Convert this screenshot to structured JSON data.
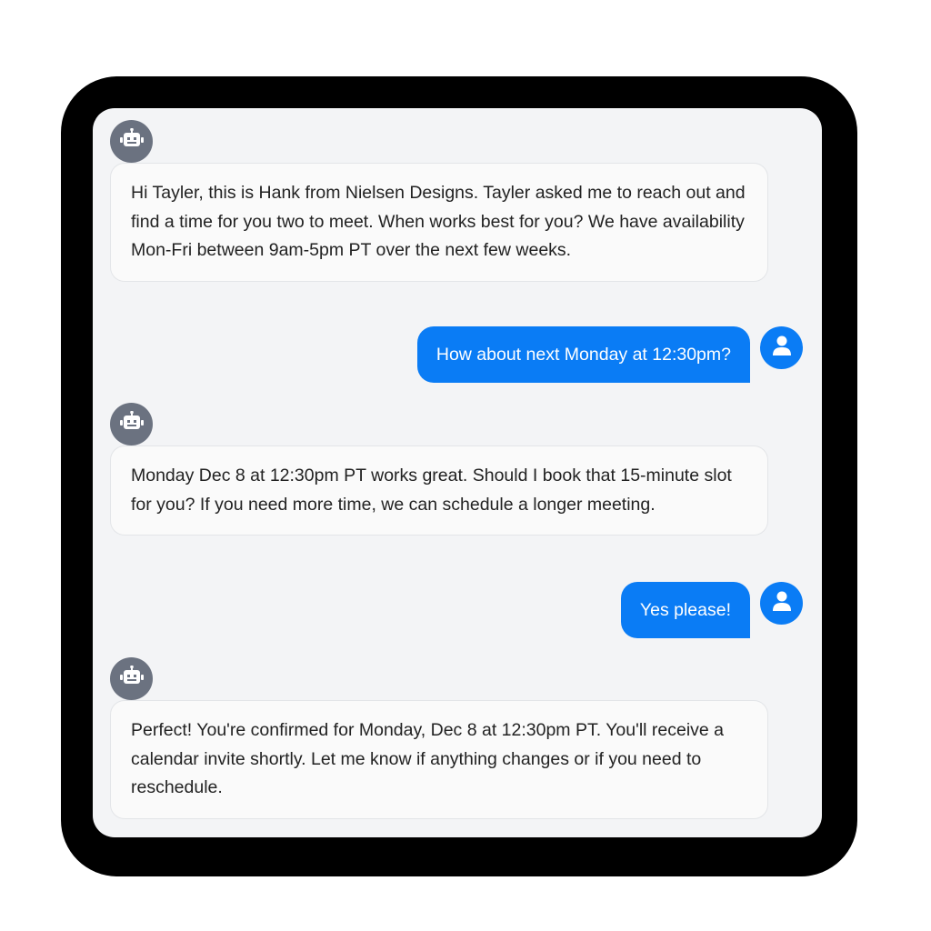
{
  "messages": [
    {
      "role": "bot",
      "avatar_icon": "robot-icon",
      "text": "Hi Tayler, this is Hank from Nielsen Designs. Tayler asked me to reach out and find a time for you two to meet. When works best for you? We have availability Mon-Fri between 9am-5pm PT over the next few weeks."
    },
    {
      "role": "user",
      "avatar_icon": "user-icon",
      "text": "How about next Monday at 12:30pm?"
    },
    {
      "role": "bot",
      "avatar_icon": "robot-icon",
      "text": "Monday Dec 8 at 12:30pm PT works great. Should I book that 15-minute slot for you? If you need more time, we can schedule a longer meeting."
    },
    {
      "role": "user",
      "avatar_icon": "user-icon",
      "text": "Yes please!"
    },
    {
      "role": "bot",
      "avatar_icon": "robot-icon",
      "text": "Perfect! You're confirmed for Monday, Dec 8 at 12:30pm PT. You'll receive a calendar invite shortly. Let me know if anything changes or if you need to reschedule."
    }
  ],
  "colors": {
    "user_bubble": "#0a7cf5",
    "bot_avatar": "#6b7280",
    "chat_background": "#f3f4f6",
    "device_frame": "#000000"
  }
}
